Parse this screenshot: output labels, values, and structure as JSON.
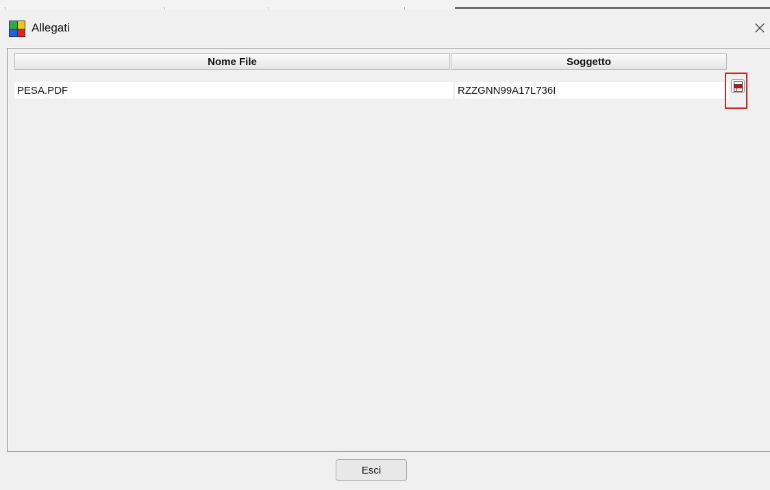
{
  "window": {
    "title": "Allegati",
    "close_glyph": "×",
    "app_icon": "colored-grid-icon"
  },
  "grid": {
    "columns": [
      "Nome File",
      "Soggetto"
    ],
    "rows": [
      {
        "file_name": "PESA.PDF",
        "subject": "RZZGNN99A17L736I",
        "action_icon": "pdf-icon"
      }
    ]
  },
  "footer": {
    "exit_label": "Esci"
  },
  "colors": {
    "highlight": "#e02020",
    "pdf_red": "#c0141b"
  }
}
